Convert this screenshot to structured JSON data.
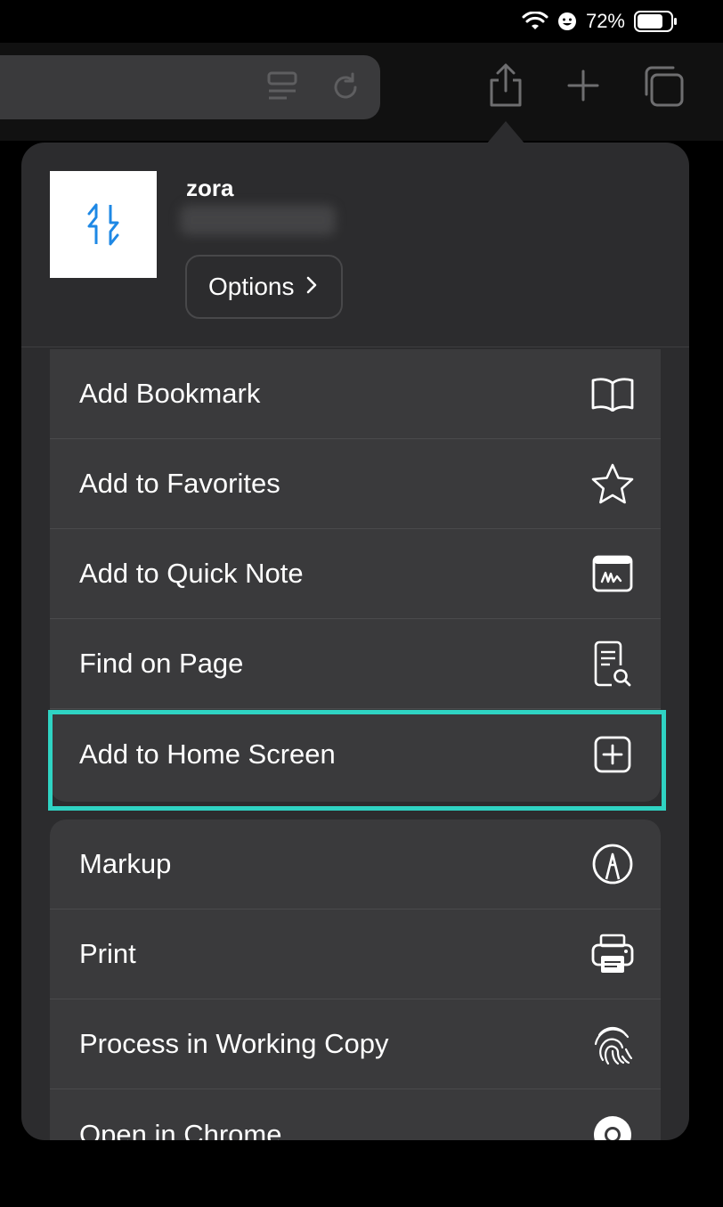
{
  "status_bar": {
    "battery_percent": "72%",
    "icons": [
      "wifi-icon",
      "focus-icon",
      "battery-icon"
    ]
  },
  "toolbar": {
    "icons": [
      "reader-icon",
      "reload-icon",
      "share-icon",
      "plus-icon",
      "tabs-icon"
    ]
  },
  "header": {
    "site_name": "zora",
    "options_label": "Options"
  },
  "actions_group1": [
    {
      "label": "Add Bookmark",
      "icon": "book-icon"
    },
    {
      "label": "Add to Favorites",
      "icon": "star-icon"
    },
    {
      "label": "Add to Quick Note",
      "icon": "quick-note-icon"
    },
    {
      "label": "Find on Page",
      "icon": "find-page-icon"
    },
    {
      "label": "Add to Home Screen",
      "icon": "add-square-icon"
    }
  ],
  "actions_group2": [
    {
      "label": "Markup",
      "icon": "markup-icon"
    },
    {
      "label": "Print",
      "icon": "printer-icon"
    },
    {
      "label": "Process in Working Copy",
      "icon": "fingerprint-icon"
    },
    {
      "label": "Open in Chrome",
      "icon": "chrome-icon"
    }
  ],
  "colors": {
    "highlight": "#2fd3c3",
    "sheet_bg": "#2c2c2e",
    "row_bg": "#3a3a3c",
    "logo_blue": "#1e88e5"
  }
}
